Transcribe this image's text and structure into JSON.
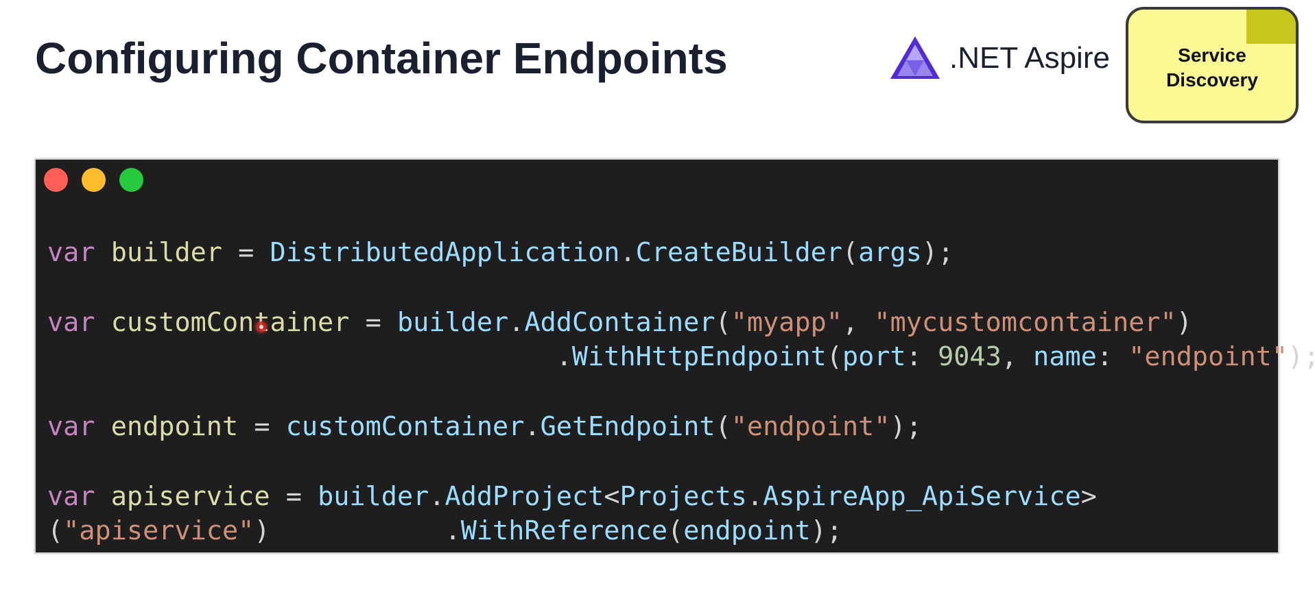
{
  "slide": {
    "title": "Configuring Container Endpoints"
  },
  "brand": {
    "name": ".NET Aspire",
    "logo_icon": "aspire-logo-icon",
    "logo_colors": [
      "#512bd4",
      "#7b5fe6",
      "#b7a6f5"
    ]
  },
  "topic_badge": {
    "label": "Service\nDiscovery",
    "background": "#fbf994",
    "corner_color": "#c6c61b"
  },
  "code_window": {
    "background": "#1e1e1e",
    "window_controls": [
      {
        "name": "close-button-icon",
        "color": "#ff5f56"
      },
      {
        "name": "minimize-button-icon",
        "color": "#ffbd2e"
      },
      {
        "name": "zoom-button-icon",
        "color": "#27c93f"
      }
    ],
    "token_colors": {
      "keyword": "#c586c0",
      "variable": "#dcdcaa",
      "identifier": "#9cdcfe",
      "string": "#ce9178",
      "number": "#b5cea8",
      "punctuation": "#d4d4d4"
    },
    "lines": [
      [
        {
          "t": "var",
          "k": "kw"
        },
        {
          "t": " ",
          "k": "op"
        },
        {
          "t": "builder",
          "k": "var"
        },
        {
          "t": " = ",
          "k": "op"
        },
        {
          "t": "DistributedApplication",
          "k": "type"
        },
        {
          "t": ".",
          "k": "op"
        },
        {
          "t": "CreateBuilder",
          "k": "type"
        },
        {
          "t": "(",
          "k": "op"
        },
        {
          "t": "args",
          "k": "type"
        },
        {
          "t": ");",
          "k": "op"
        }
      ],
      [],
      [
        {
          "t": "var",
          "k": "kw"
        },
        {
          "t": " ",
          "k": "op"
        },
        {
          "t": "customContainer",
          "k": "var"
        },
        {
          "t": " = ",
          "k": "op"
        },
        {
          "t": "builder",
          "k": "type"
        },
        {
          "t": ".",
          "k": "op"
        },
        {
          "t": "AddContainer",
          "k": "type"
        },
        {
          "t": "(",
          "k": "op"
        },
        {
          "t": "\"myapp\"",
          "k": "str"
        },
        {
          "t": ", ",
          "k": "op"
        },
        {
          "t": "\"mycustomcontainer\"",
          "k": "str"
        },
        {
          "t": ")",
          "k": "op"
        }
      ],
      [
        {
          "t": "                                ",
          "k": "op"
        },
        {
          "t": ".",
          "k": "op"
        },
        {
          "t": "WithHttpEndpoint",
          "k": "type"
        },
        {
          "t": "(",
          "k": "op"
        },
        {
          "t": "port",
          "k": "type"
        },
        {
          "t": ": ",
          "k": "op"
        },
        {
          "t": "9043",
          "k": "num"
        },
        {
          "t": ", ",
          "k": "op"
        },
        {
          "t": "name",
          "k": "type"
        },
        {
          "t": ": ",
          "k": "op"
        },
        {
          "t": "\"endpoint\"",
          "k": "str"
        },
        {
          "t": ");",
          "k": "op"
        }
      ],
      [],
      [
        {
          "t": "var",
          "k": "kw"
        },
        {
          "t": " ",
          "k": "op"
        },
        {
          "t": "endpoint",
          "k": "var"
        },
        {
          "t": " = ",
          "k": "op"
        },
        {
          "t": "customContainer",
          "k": "type"
        },
        {
          "t": ".",
          "k": "op"
        },
        {
          "t": "GetEndpoint",
          "k": "type"
        },
        {
          "t": "(",
          "k": "op"
        },
        {
          "t": "\"endpoint\"",
          "k": "str"
        },
        {
          "t": ");",
          "k": "op"
        }
      ],
      [],
      [
        {
          "t": "var",
          "k": "kw"
        },
        {
          "t": " ",
          "k": "op"
        },
        {
          "t": "apiservice",
          "k": "var"
        },
        {
          "t": " = ",
          "k": "op"
        },
        {
          "t": "builder",
          "k": "type"
        },
        {
          "t": ".",
          "k": "op"
        },
        {
          "t": "AddProject",
          "k": "type"
        },
        {
          "t": "<",
          "k": "op"
        },
        {
          "t": "Projects",
          "k": "type"
        },
        {
          "t": ".",
          "k": "op"
        },
        {
          "t": "AspireApp_ApiService",
          "k": "type"
        },
        {
          "t": ">",
          "k": "op"
        }
      ],
      [
        {
          "t": "(",
          "k": "op"
        },
        {
          "t": "\"apiservice\"",
          "k": "str"
        },
        {
          "t": ")",
          "k": "op"
        },
        {
          "t": "           ",
          "k": "op"
        },
        {
          "t": ".",
          "k": "op"
        },
        {
          "t": "WithReference",
          "k": "type"
        },
        {
          "t": "(",
          "k": "op"
        },
        {
          "t": "endpoint",
          "k": "type"
        },
        {
          "t": ");",
          "k": "op"
        }
      ]
    ]
  }
}
